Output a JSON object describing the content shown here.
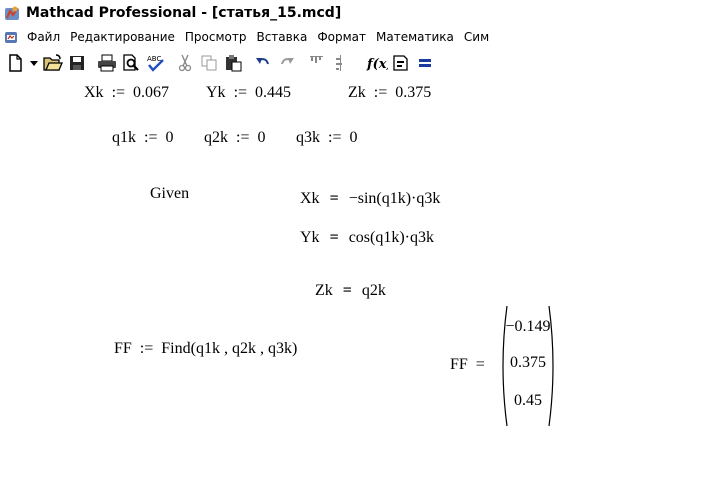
{
  "window": {
    "title": "Mathcad Professional - [статья_15.mcd]"
  },
  "menu": {
    "items": [
      "Файл",
      "Редактирование",
      "Просмотр",
      "Вставка",
      "Формат",
      "Математика",
      "Сим"
    ]
  },
  "toolbar": {
    "buttons": [
      "new-document-icon",
      "dropdown-arrow-icon",
      "open-folder-icon",
      "save-icon",
      "print-icon",
      "print-preview-icon",
      "spell-check-icon",
      "cut-icon",
      "copy-icon",
      "paste-icon",
      "undo-icon",
      "redo-icon",
      "align-horizontal-icon",
      "align-vertical-icon",
      "insert-function-icon",
      "insert-unit-icon",
      "evaluate-icon"
    ]
  },
  "worksheet": {
    "row1": {
      "xk_var": "Xk",
      "xk_val": "0.067",
      "yk_var": "Yk",
      "yk_val": "0.445",
      "zk_var": "Zk",
      "zk_val": "0.375"
    },
    "row2": {
      "q1_var": "q1k",
      "q1_val": "0",
      "q2_var": "q2k",
      "q2_val": "0",
      "q3_var": "q3k",
      "q3_val": "0"
    },
    "given_label": "Given",
    "eq1": {
      "lhs": "Xk",
      "rhs": "−sin(q1k)·q3k"
    },
    "eq2": {
      "lhs": "Yk",
      "rhs": "cos(q1k)·q3k"
    },
    "eq3": {
      "lhs": "Zk",
      "rhs": "q2k"
    },
    "find": {
      "lhs": "FF",
      "rhs": "Find(q1k , q2k , q3k)"
    },
    "result": {
      "lhs": "FF",
      "values": [
        "−0.149",
        "0.375",
        "0.45"
      ]
    },
    "assign_symbol": ":=",
    "bold_equal_symbol": "=",
    "eval_symbol": "="
  }
}
